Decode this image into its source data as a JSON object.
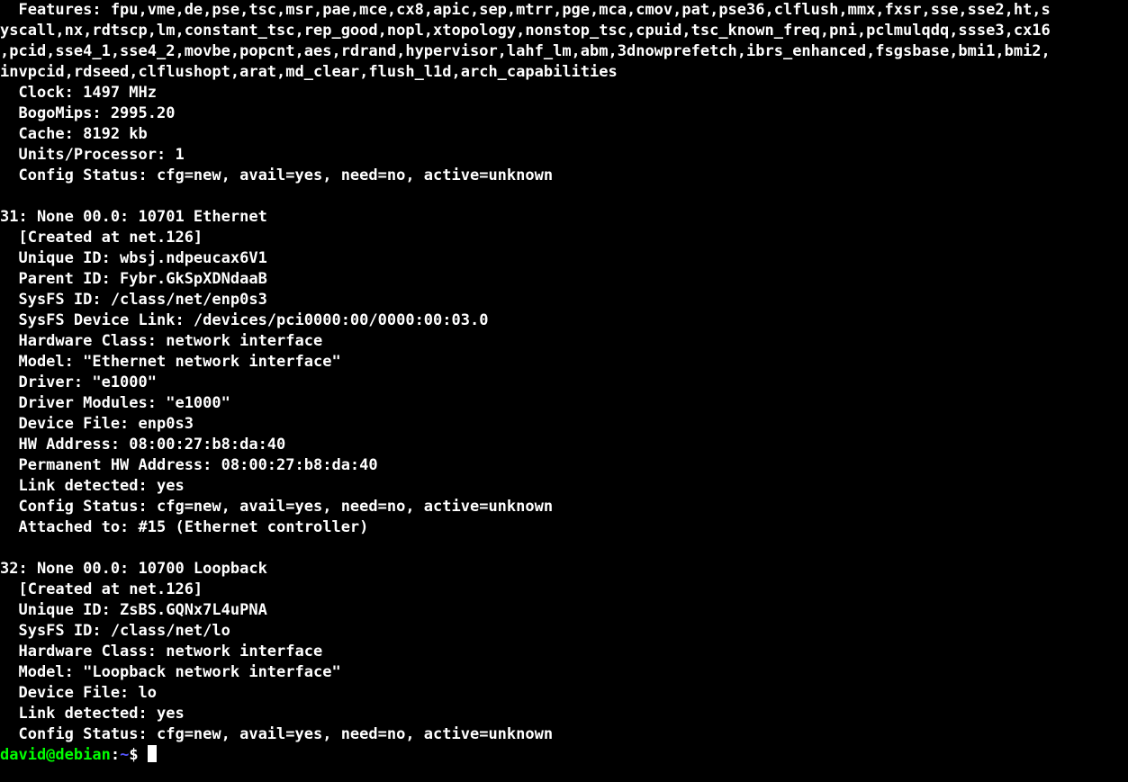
{
  "terminal": {
    "lines": [
      "  Features: fpu,vme,de,pse,tsc,msr,pae,mce,cx8,apic,sep,mtrr,pge,mca,cmov,pat,pse36,clflush,mmx,fxsr,sse,sse2,ht,s",
      "yscall,nx,rdtscp,lm,constant_tsc,rep_good,nopl,xtopology,nonstop_tsc,cpuid,tsc_known_freq,pni,pclmulqdq,ssse3,cx16",
      ",pcid,sse4_1,sse4_2,movbe,popcnt,aes,rdrand,hypervisor,lahf_lm,abm,3dnowprefetch,ibrs_enhanced,fsgsbase,bmi1,bmi2,",
      "invpcid,rdseed,clflushopt,arat,md_clear,flush_l1d,arch_capabilities",
      "  Clock: 1497 MHz",
      "  BogoMips: 2995.20",
      "  Cache: 8192 kb",
      "  Units/Processor: 1",
      "  Config Status: cfg=new, avail=yes, need=no, active=unknown",
      "",
      "31: None 00.0: 10701 Ethernet",
      "  [Created at net.126]",
      "  Unique ID: wbsj.ndpeucax6V1",
      "  Parent ID: Fybr.GkSpXDNdaaB",
      "  SysFS ID: /class/net/enp0s3",
      "  SysFS Device Link: /devices/pci0000:00/0000:00:03.0",
      "  Hardware Class: network interface",
      "  Model: \"Ethernet network interface\"",
      "  Driver: \"e1000\"",
      "  Driver Modules: \"e1000\"",
      "  Device File: enp0s3",
      "  HW Address: 08:00:27:b8:da:40",
      "  Permanent HW Address: 08:00:27:b8:da:40",
      "  Link detected: yes",
      "  Config Status: cfg=new, avail=yes, need=no, active=unknown",
      "  Attached to: #15 (Ethernet controller)",
      "",
      "32: None 00.0: 10700 Loopback",
      "  [Created at net.126]",
      "  Unique ID: ZsBS.GQNx7L4uPNA",
      "  SysFS ID: /class/net/lo",
      "  Hardware Class: network interface",
      "  Model: \"Loopback network interface\"",
      "  Device File: lo",
      "  Link detected: yes",
      "  Config Status: cfg=new, avail=yes, need=no, active=unknown"
    ],
    "prompt": {
      "user_host": "david@debian",
      "colon": ":",
      "path": "~",
      "dollar": "$ "
    }
  }
}
